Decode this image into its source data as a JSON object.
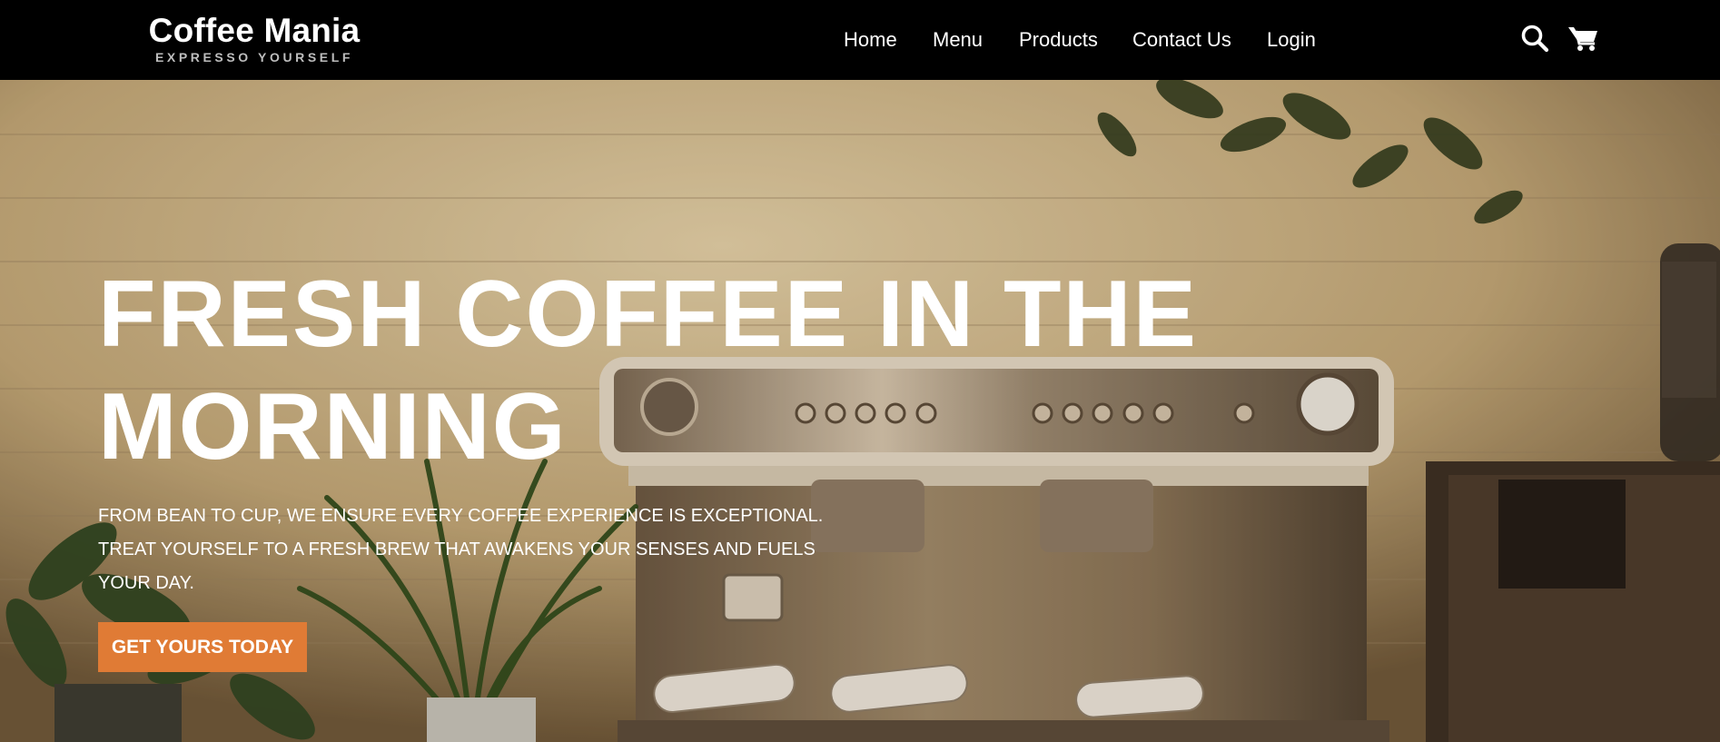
{
  "brand": {
    "name": "Coffee Mania",
    "tagline": "EXPRESSO YOURSELF"
  },
  "nav": {
    "items": [
      {
        "label": "Home"
      },
      {
        "label": "Menu"
      },
      {
        "label": "Products"
      },
      {
        "label": "Contact Us"
      },
      {
        "label": "Login"
      }
    ],
    "icons": [
      "search-icon",
      "cart-icon"
    ]
  },
  "hero": {
    "title_lines": [
      "FRESH COFFEE IN THE",
      "MORNING"
    ],
    "subtitle_lines": [
      "FROM BEAN TO CUP, WE ENSURE EVERY COFFEE EXPERIENCE IS EXCEPTIONAL.",
      "TREAT YOURSELF TO A FRESH BREW THAT AWAKENS YOUR SENSES AND FUELS",
      "YOUR DAY."
    ],
    "cta_label": "GET YOURS TODAY"
  },
  "colors": {
    "header_bg": "#000000",
    "accent": "#e07b35",
    "text_light": "#ffffff"
  }
}
